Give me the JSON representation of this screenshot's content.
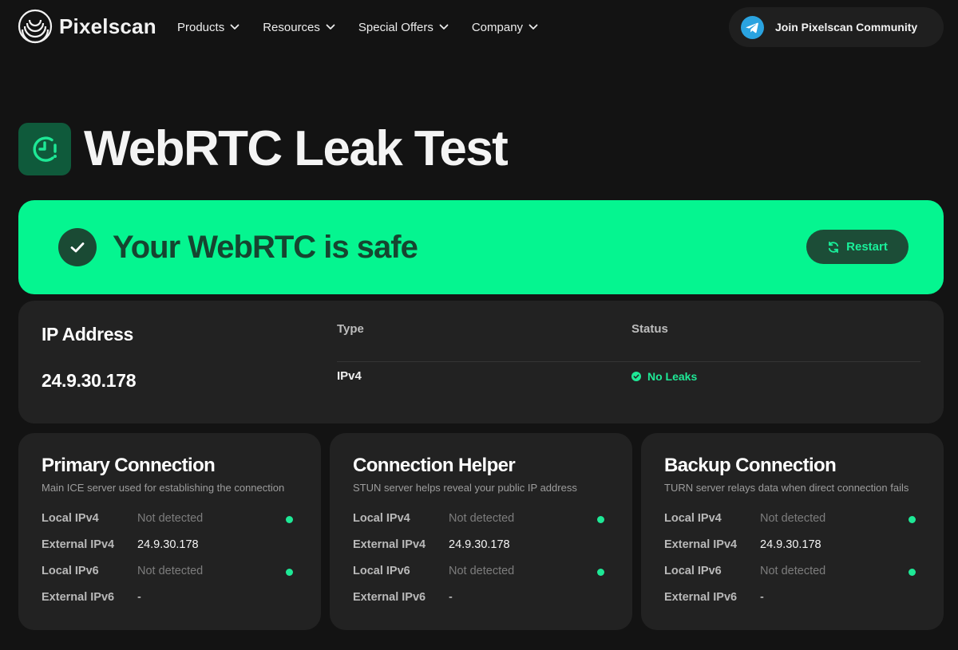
{
  "header": {
    "brand": "Pixelscan",
    "nav": [
      {
        "label": "Products"
      },
      {
        "label": "Resources"
      },
      {
        "label": "Special Offers"
      },
      {
        "label": "Company"
      }
    ],
    "community_button": "Join Pixelscan Community"
  },
  "page": {
    "title": "WebRTC Leak Test"
  },
  "banner": {
    "message": "Your WebRTC is safe",
    "restart_label": "Restart"
  },
  "ip_card": {
    "heading": "IP Address",
    "value": "24.9.30.178",
    "type_heading": "Type",
    "type_value": "IPv4",
    "status_heading": "Status",
    "status_value": "No Leaks"
  },
  "servers": [
    {
      "title": "Primary Connection",
      "subtitle": "Main ICE server used for establishing the connection",
      "rows": [
        {
          "label": "Local IPv4",
          "value": "Not detected"
        },
        {
          "label": "External IPv4",
          "value": "24.9.30.178"
        },
        {
          "label": "Local IPv6",
          "value": "Not detected"
        },
        {
          "label": "External IPv6",
          "value": "-"
        }
      ]
    },
    {
      "title": "Connection Helper",
      "subtitle": "STUN server helps reveal your public IP address",
      "rows": [
        {
          "label": "Local IPv4",
          "value": "Not detected"
        },
        {
          "label": "External IPv4",
          "value": "24.9.30.178"
        },
        {
          "label": "Local IPv6",
          "value": "Not detected"
        },
        {
          "label": "External IPv6",
          "value": "-"
        }
      ]
    },
    {
      "title": "Backup Connection",
      "subtitle": "TURN server relays data when direct connection fails",
      "rows": [
        {
          "label": "Local IPv4",
          "value": "Not detected"
        },
        {
          "label": "External IPv4",
          "value": "24.9.30.178"
        },
        {
          "label": "Local IPv6",
          "value": "Not detected"
        },
        {
          "label": "External IPv6",
          "value": "-"
        }
      ]
    }
  ],
  "icons": {
    "logo": "pixelscan-logo-icon",
    "chevron": "chevron-down-icon",
    "telegram": "telegram-icon",
    "title_badge": "webrtc-alert-icon",
    "check": "check-icon",
    "restart": "refresh-icon",
    "status_ok": "check-circle-icon",
    "detected_dot": "status-dot-icon"
  },
  "colors": {
    "background": "#131313",
    "card": "#222222",
    "accent": "#05f590",
    "accent_dark": "#164530",
    "ok": "#1ee896",
    "telegram": "#2aa3e0"
  }
}
